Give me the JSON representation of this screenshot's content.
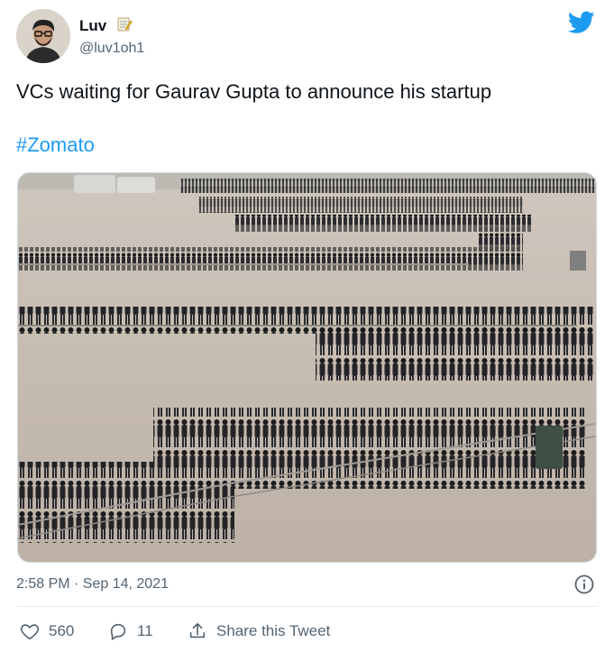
{
  "user": {
    "name": "Luv",
    "handle": "@luv1oh1"
  },
  "tweet": {
    "text": "VCs waiting for Gaurav Gupta to announce his startup",
    "hashtag": "#Zomato",
    "timestamp": "2:58 PM · Sep 14, 2021"
  },
  "actions": {
    "likes": "560",
    "replies": "11",
    "share_label": "Share this Tweet"
  },
  "colors": {
    "accent": "#1d9bf0",
    "muted": "#536471"
  },
  "icons": [
    "memo-icon",
    "twitter-bird-icon",
    "info-icon",
    "heart-icon",
    "reply-icon",
    "share-icon"
  ]
}
